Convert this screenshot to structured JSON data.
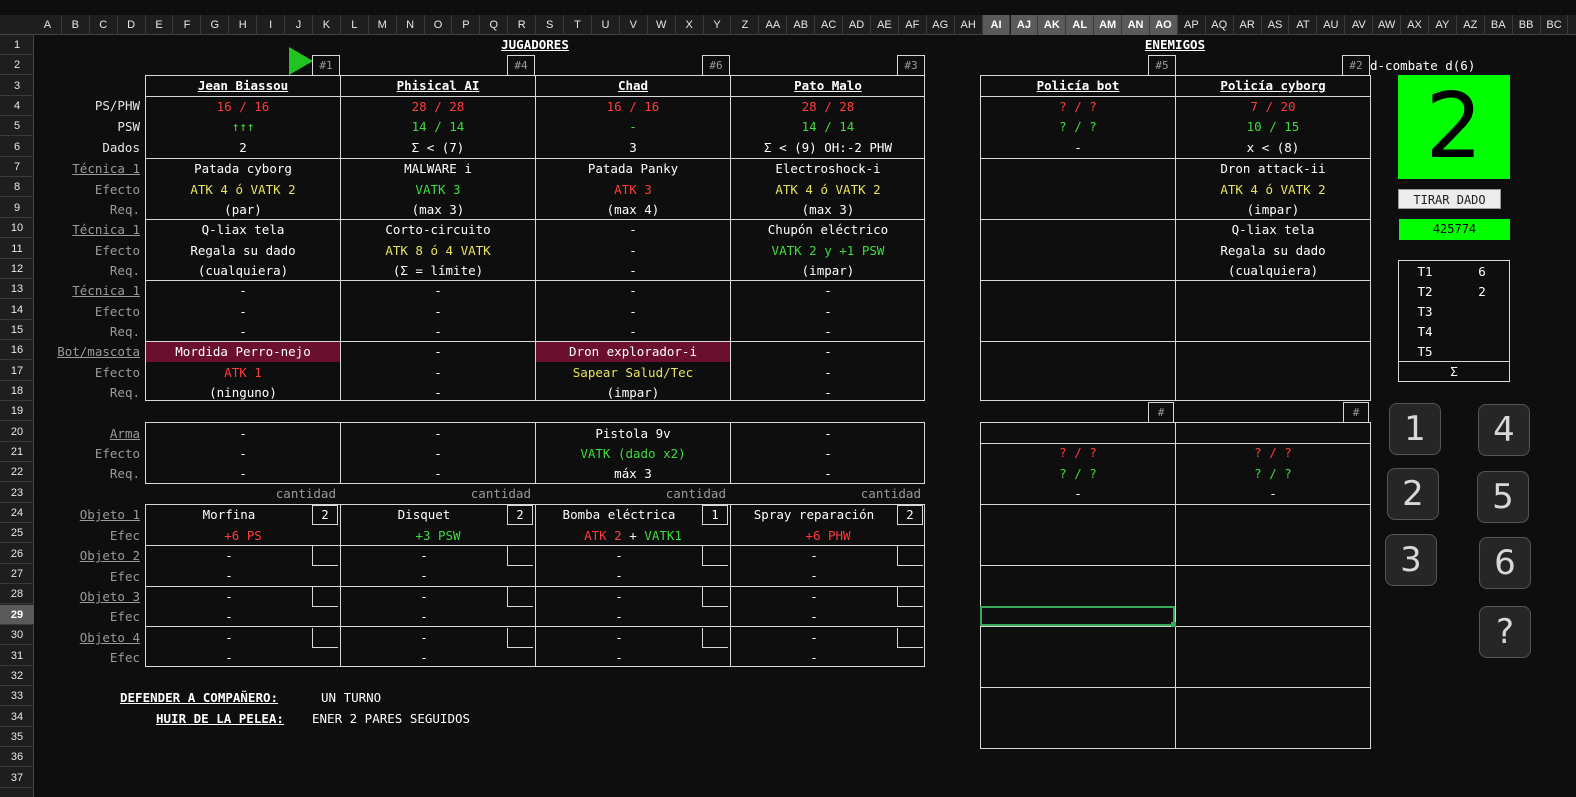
{
  "sheet": {
    "columns": [
      "A",
      "B",
      "C",
      "D",
      "E",
      "F",
      "G",
      "H",
      "I",
      "J",
      "K",
      "L",
      "M",
      "N",
      "O",
      "P",
      "Q",
      "R",
      "S",
      "T",
      "U",
      "V",
      "W",
      "X",
      "Y",
      "Z",
      "AA",
      "AB",
      "AC",
      "AD",
      "AE",
      "AF",
      "AG",
      "AH",
      "AI",
      "AJ",
      "AK",
      "AL",
      "AM",
      "AN",
      "AO",
      "AP",
      "AQ",
      "AR",
      "AS",
      "AT",
      "AU",
      "AV",
      "AW",
      "AX",
      "AY",
      "AZ",
      "BA",
      "BB",
      "BC"
    ],
    "selected_columns": [
      "AI",
      "AJ",
      "AK",
      "AL",
      "AM",
      "AN",
      "AO"
    ],
    "rows": [
      "1",
      "2",
      "3",
      "4",
      "5",
      "6",
      "7",
      "8",
      "9",
      "10",
      "11",
      "12",
      "13",
      "14",
      "15",
      "16",
      "17",
      "18",
      "19",
      "20",
      "21",
      "22",
      "23",
      "24",
      "25",
      "26",
      "27",
      "28",
      "29",
      "30",
      "31",
      "32",
      "33",
      "34",
      "35",
      "36",
      "37"
    ],
    "selected_row": "29"
  },
  "headers": {
    "players": "JUGADORES",
    "enemies": "ENEMIGOS"
  },
  "labels": {
    "ps_phw": "PS/PHW",
    "psw": "PSW",
    "dados": "Dados",
    "tecnica": "Técnica 1",
    "efecto": "Efecto",
    "req": "Req.",
    "bot": "Bot/mascota",
    "arma": "Arma",
    "cantidad": "cantidad",
    "objeto1": "Objeto 1",
    "objeto2": "Objeto 2",
    "objeto3": "Objeto 3",
    "objeto4": "Objeto 4",
    "efec": "Efec"
  },
  "players": [
    {
      "tag": "#1",
      "name": "Jean Biassou",
      "ps": "16 / 16",
      "psw": "↑↑↑",
      "dados": "2",
      "t1": [
        "Patada cyborg",
        "ATK 4 ó VATK 2",
        "(par)"
      ],
      "t2": [
        "Q-liax tela",
        "Regala su dado",
        "(cualquiera)"
      ],
      "t3": [
        "-",
        "-",
        "-"
      ],
      "bot": [
        "Mordida Perro-nejo",
        "ATK 1",
        "(ninguno)"
      ],
      "arma": [
        "-",
        "-",
        "-"
      ],
      "obj1": {
        "name": "Morfina",
        "qty": "2",
        "effect": "+6 PS"
      },
      "obj2": [
        "-",
        "-"
      ],
      "obj3": [
        "-",
        "-"
      ],
      "obj4": [
        "-",
        "-"
      ]
    },
    {
      "tag": "#4",
      "name": "Phisical AI",
      "ps": "28 / 28",
      "psw": "14 / 14",
      "dados": "Σ < (7)",
      "t1": [
        "MALWARE i",
        "VATK 3",
        "(max 3)"
      ],
      "t2": [
        "Corto-circuito",
        "ATK 8 ó 4 VATK",
        "(Σ = límite)"
      ],
      "t3": [
        "-",
        "-",
        "-"
      ],
      "bot": [
        "-",
        "-",
        "-"
      ],
      "arma": [
        "-",
        "-",
        "-"
      ],
      "obj1": {
        "name": "Disquet",
        "qty": "2",
        "effect": "+3 PSW"
      },
      "obj2": [
        "-",
        "-"
      ],
      "obj3": [
        "-",
        "-"
      ],
      "obj4": [
        "-",
        "-"
      ]
    },
    {
      "tag": "#6",
      "name": "Chad",
      "ps": "16 / 16",
      "psw": "-",
      "dados": "3",
      "t1": [
        "Patada Panky",
        "ATK 3",
        "(max 4)"
      ],
      "t2": [
        "-",
        "-",
        "-"
      ],
      "t3": [
        "-",
        "-",
        "-"
      ],
      "bot": [
        "Dron explorador-i",
        "Sapear Salud/Tec",
        "(impar)"
      ],
      "arma": [
        "Pistola 9v",
        "VATK (dado x2)",
        "máx 3"
      ],
      "obj1": {
        "name": "Bomba eléctrica",
        "qty": "1",
        "effect_a": "ATK 2",
        "effect_b": "+",
        "effect_c": "VATK1"
      },
      "obj2": [
        "-",
        "-"
      ],
      "obj3": [
        "-",
        "-"
      ],
      "obj4": [
        "-",
        "-"
      ]
    },
    {
      "tag": "#3",
      "name": "Pato Malo",
      "ps": "28 / 28",
      "psw": "14 / 14",
      "dados": "Σ < (9) OH:-2 PHW",
      "t1": [
        "Electroshock-i",
        "ATK 4 ó VATK 2",
        "(max 3)"
      ],
      "t2": [
        "Chupón eléctrico",
        "VATK 2 y +1 PSW",
        "(impar)"
      ],
      "t3": [
        "-",
        "-",
        "-"
      ],
      "bot": [
        "-",
        "-",
        "-"
      ],
      "arma": [
        "-",
        "-",
        "-"
      ],
      "obj1": {
        "name": "Spray reparación",
        "qty": "2",
        "effect": "+6 PHW"
      },
      "obj2": [
        "-",
        "-"
      ],
      "obj3": [
        "-",
        "-"
      ],
      "obj4": [
        "-",
        "-"
      ]
    }
  ],
  "enemies": [
    {
      "tag": "#5",
      "name": "Policía bot",
      "ps": "? / ?",
      "psw": "? / ?",
      "dados": "-",
      "t1": [
        "",
        "",
        ""
      ],
      "t2": [
        "",
        "",
        ""
      ],
      "hash": "#",
      "ps2": "? / ?",
      "psw2": "? / ?",
      "dados2": "-"
    },
    {
      "tag": "#2",
      "name": "Policía cyborg",
      "ps": "7 / 20",
      "psw": "10 / 15",
      "dados": "x < (8)",
      "t1": [
        "Dron attack-ii",
        "ATK 4 ó VATK 2",
        "(impar)"
      ],
      "t2": [
        "Q-liax tela",
        "Regala su dado",
        "(cualquiera)"
      ],
      "hash": "#",
      "ps2": "? / ?",
      "psw2": "? / ?",
      "dados2": "-"
    }
  ],
  "dice": {
    "title": "d-combate d(6)",
    "value": "2",
    "roll_button": "TIRAR DADO",
    "seed": "425774",
    "turns": [
      {
        "label": "T1",
        "value": "6"
      },
      {
        "label": "T2",
        "value": "2"
      },
      {
        "label": "T3",
        "value": ""
      },
      {
        "label": "T4",
        "value": ""
      },
      {
        "label": "T5",
        "value": ""
      }
    ],
    "sum_label": "Σ",
    "buttons": [
      "1",
      "2",
      "3",
      "4",
      "5",
      "6",
      "?"
    ],
    "color": "#00ff00"
  },
  "notes": {
    "defend_label": "DEFENDER A COMPAÑERO:",
    "defend_value": "UN TURNO",
    "flee_label": "HUIR DE LA PELEA:",
    "flee_value": "ENER 2 PARES SEGUIDOS"
  },
  "colors": {
    "red": "#ff3b3b",
    "green": "#3ddc3d",
    "yellow": "#e8e35a",
    "maroon": "#6b0f2e",
    "bg": "#0e0e0e"
  }
}
